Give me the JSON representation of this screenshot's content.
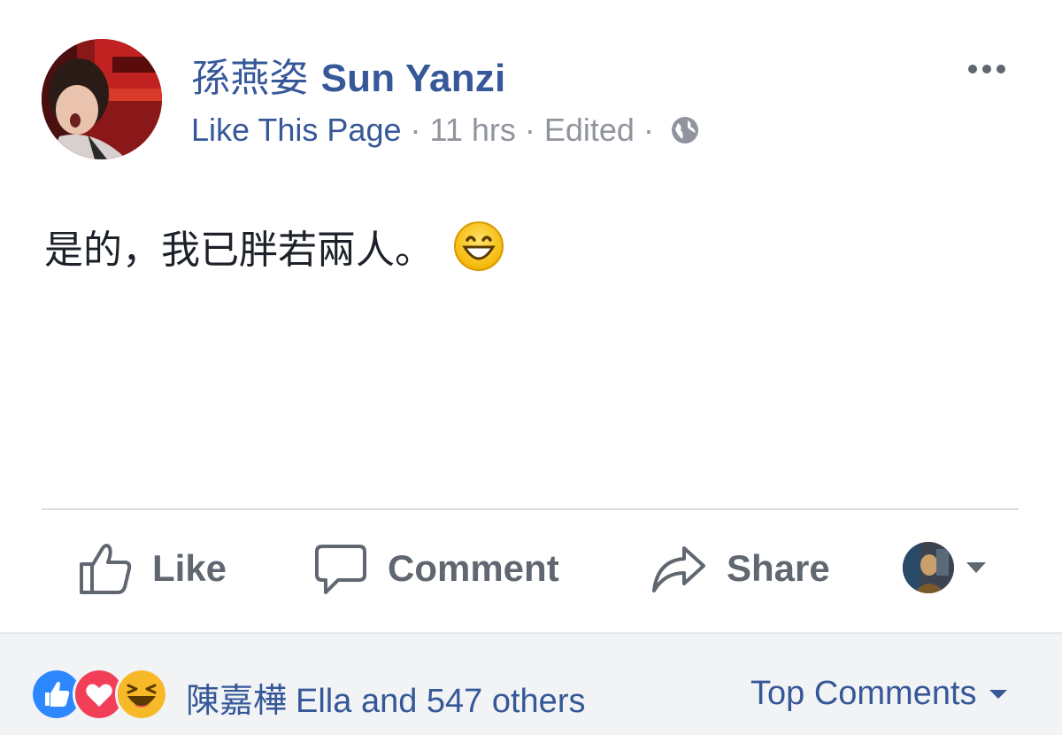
{
  "post": {
    "page_name_cjk": "孫燕姿",
    "page_name_latin": "Sun Yanzi",
    "like_page_label": "Like This Page",
    "separator": "·",
    "time": "11 hrs",
    "edited": "Edited",
    "privacy_icon": "globe-icon",
    "more_icon": "more-options-icon",
    "text": "是的，我已胖若兩人。",
    "emoji": "grinning-face-emoji"
  },
  "actions": {
    "like_label": "Like",
    "comment_label": "Comment",
    "share_label": "Share"
  },
  "footer": {
    "reaction_icons": [
      "like-reaction-icon",
      "love-reaction-icon",
      "haha-reaction-icon"
    ],
    "reactor_cjk": "陳嘉樺",
    "reactor_rest": "Ella and 547 others",
    "sort_label": "Top Comments"
  },
  "colors": {
    "link_blue": "#365899",
    "meta_gray": "#90949c",
    "action_gray": "#606770",
    "like_blue": "#2d88ff",
    "love_red": "#f33e58",
    "haha_yellow": "#f7b928"
  }
}
